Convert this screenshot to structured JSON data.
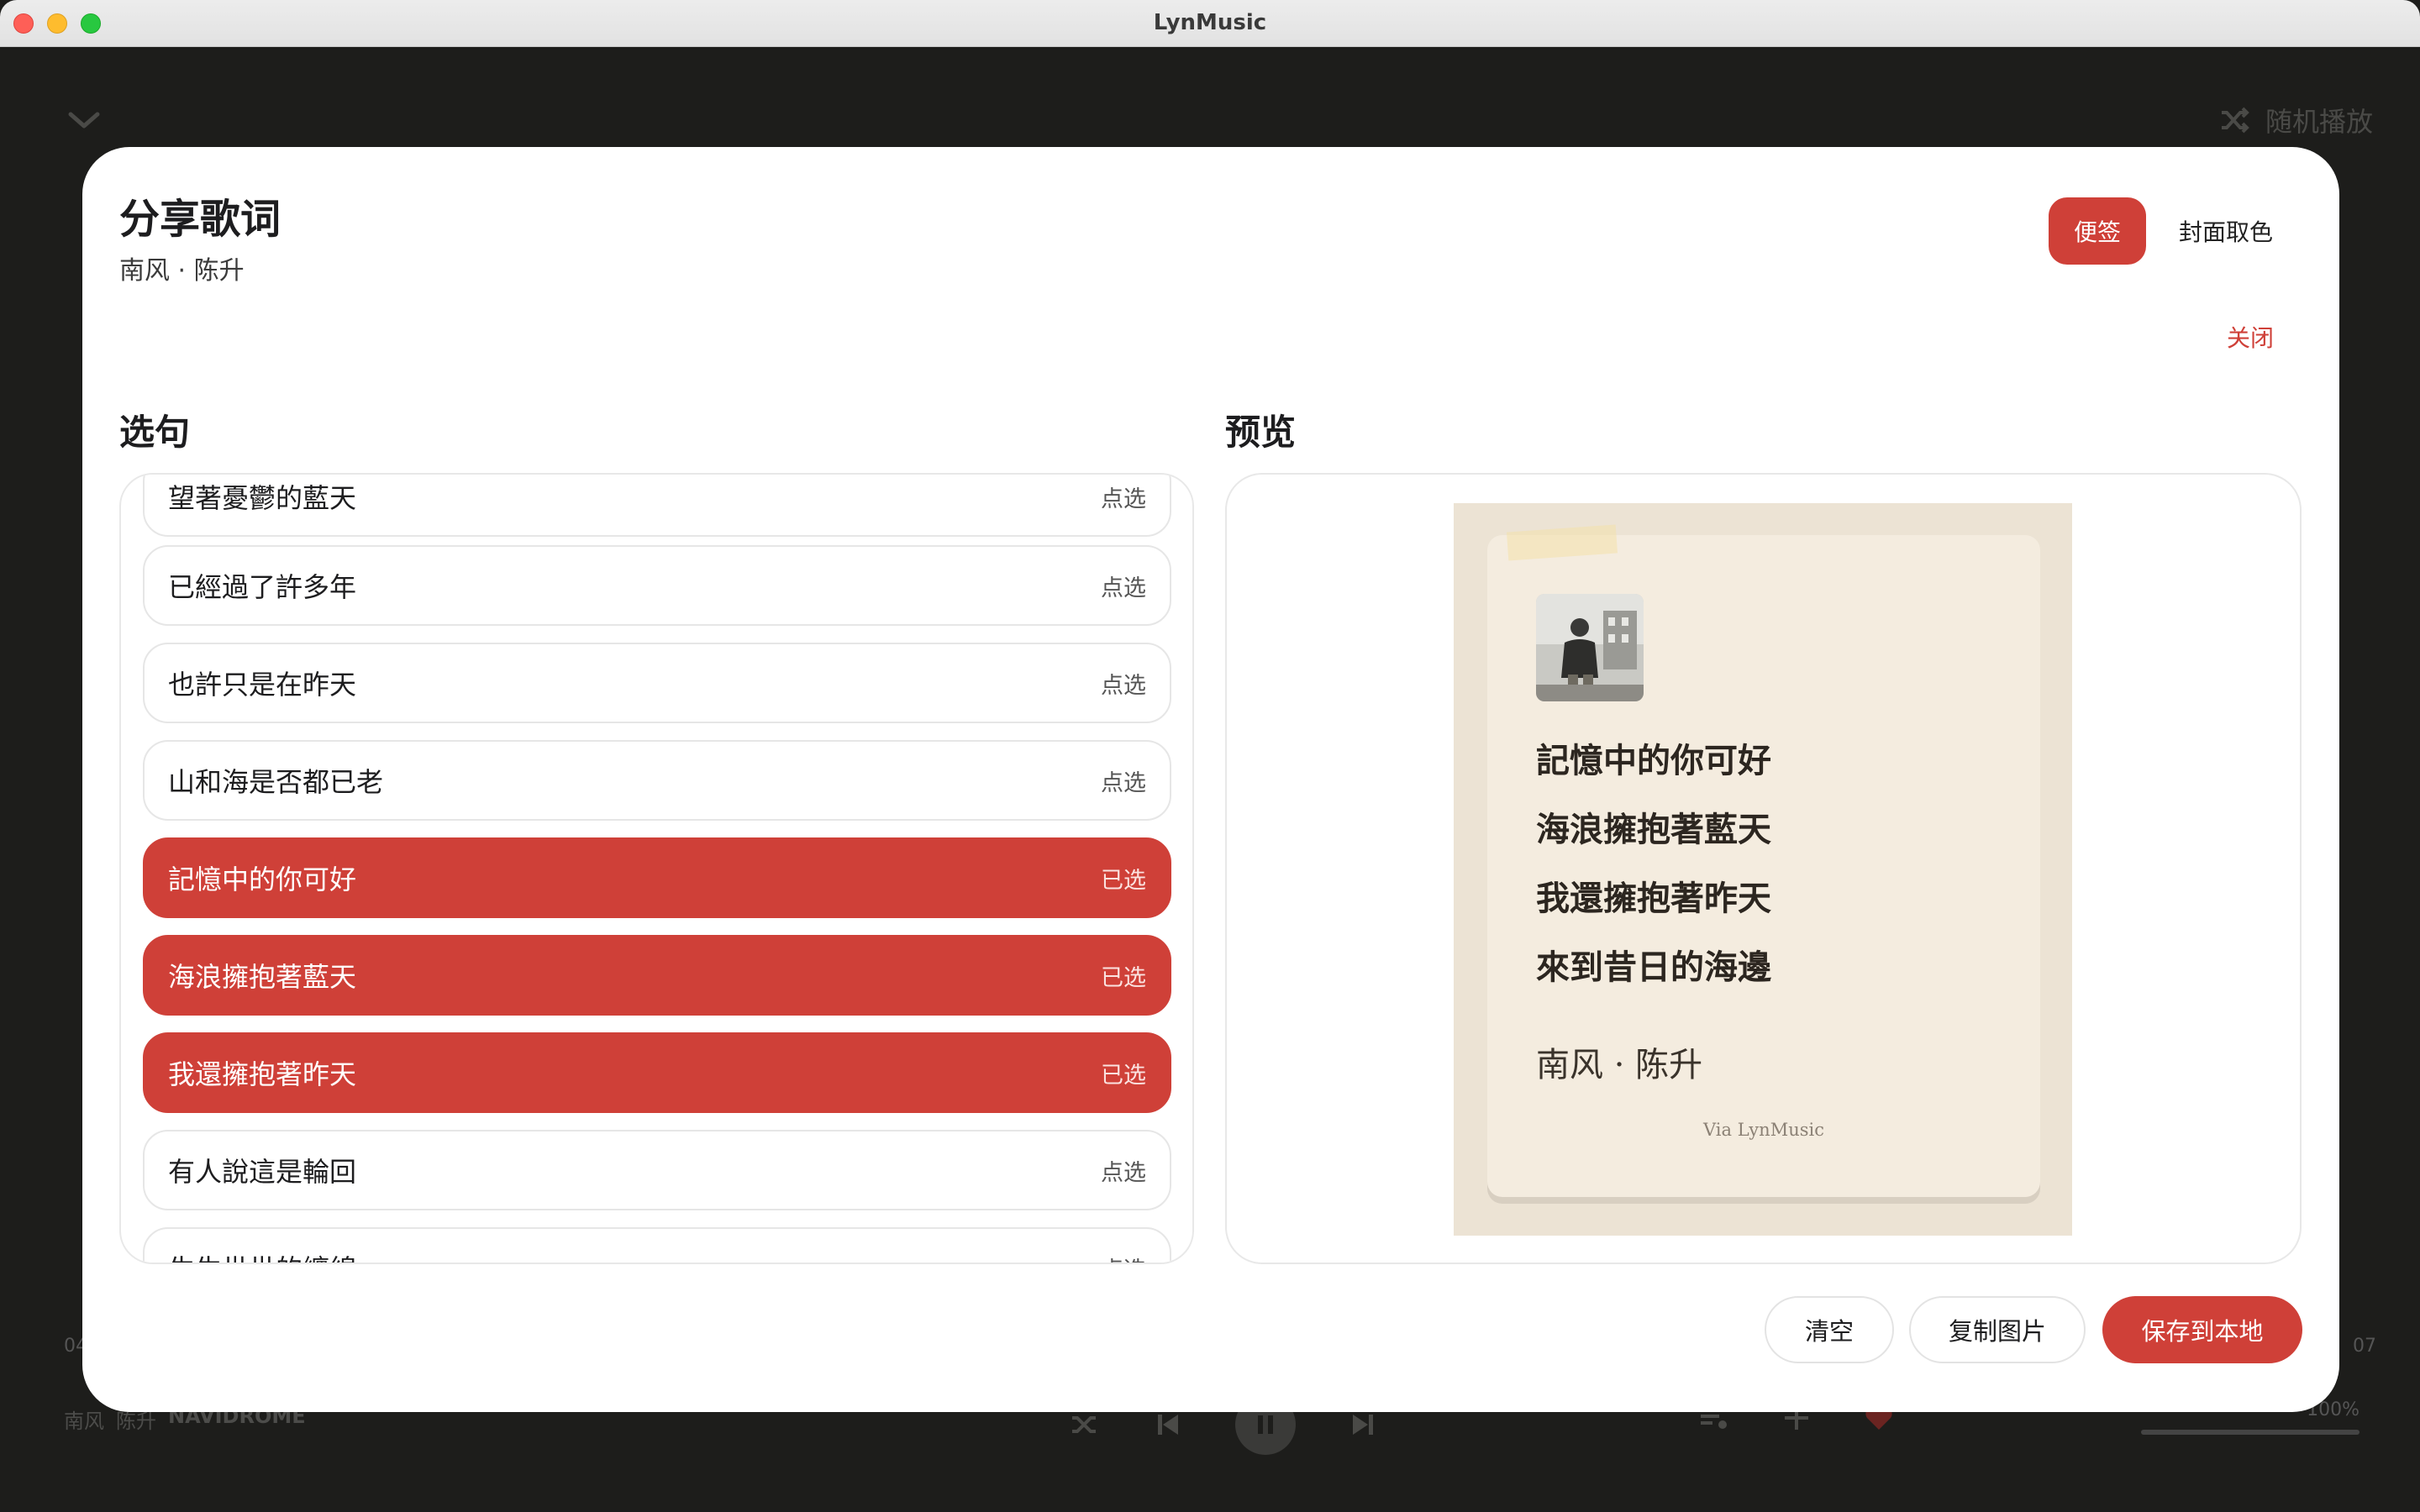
{
  "window": {
    "title": "LynMusic"
  },
  "player": {
    "shuffle_label": "随机播放",
    "time_left": "04",
    "time_right": "07",
    "song": "南风",
    "artist": "陈升",
    "source": "NAVIDROME",
    "volume": "100%"
  },
  "modal": {
    "title": "分享歌词",
    "subtitle": "南风 · 陈升",
    "styles": [
      "便签",
      "封面取色"
    ],
    "close_label": "关闭",
    "select_label": "选句",
    "preview_label": "预览",
    "lyrics": [
      {
        "text": "望著憂鬱的藍天",
        "tag": "点选",
        "selected": false
      },
      {
        "text": "已經過了許多年",
        "tag": "点选",
        "selected": false
      },
      {
        "text": "也許只是在昨天",
        "tag": "点选",
        "selected": false
      },
      {
        "text": "山和海是否都已老",
        "tag": "点选",
        "selected": false
      },
      {
        "text": "記憶中的你可好",
        "tag": "已选",
        "selected": true
      },
      {
        "text": "海浪擁抱著藍天",
        "tag": "已选",
        "selected": true
      },
      {
        "text": "我還擁抱著昨天",
        "tag": "已选",
        "selected": true
      },
      {
        "text": "有人說這是輪回",
        "tag": "点选",
        "selected": false
      },
      {
        "text": "生生世世的纏綿",
        "tag": "点选",
        "selected": false
      }
    ],
    "preview": {
      "lines": [
        "記憶中的你可好",
        "海浪擁抱著藍天",
        "我還擁抱著昨天",
        "來到昔日的海邊"
      ],
      "meta": "南风 · 陈升",
      "via": "Via LynMusic"
    },
    "buttons": {
      "clear": "清空",
      "copy": "复制图片",
      "save": "保存到本地"
    }
  },
  "colors": {
    "accent": "#cf4038",
    "note_bg": "#ece3d4",
    "note_card": "#f4ecdf"
  }
}
